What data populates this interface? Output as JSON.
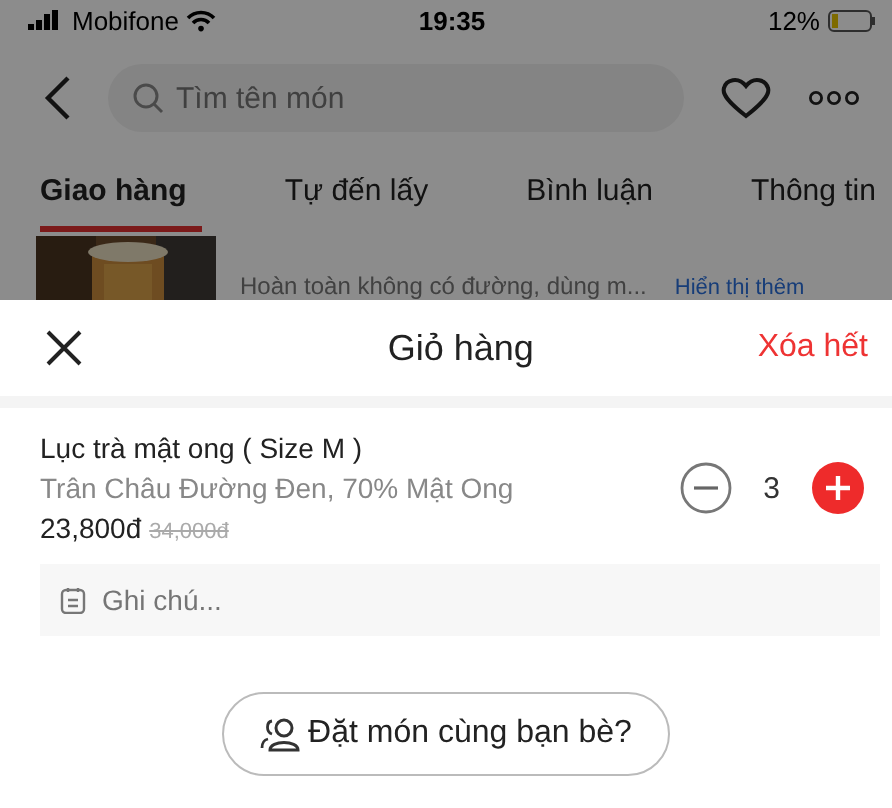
{
  "status_bar": {
    "carrier": "Mobifone",
    "time": "19:35",
    "battery": "12%"
  },
  "nav": {
    "search": {
      "placeholder": "Tìm tên món"
    }
  },
  "tabs": [
    {
      "label": "Giao hàng",
      "selected": true
    },
    {
      "label": "Tự đến lấy",
      "selected": false
    },
    {
      "label": "Bình luận",
      "selected": false
    },
    {
      "label": "Thông tin",
      "selected": false
    }
  ],
  "menu_item": {
    "kind": "picture",
    "description": "Hoàn toàn không có đường, dùng m...",
    "more_link": "Hiển thị thêm"
  },
  "cart": {
    "title": "Giỏ hàng",
    "clear_all": "Xóa hết",
    "items": [
      {
        "name": "Lục trà mật ong ( Size M )",
        "options": "Trân Châu Đường Đen, 70% Mật Ong",
        "price": "23,800đ",
        "old_price": "34,000đ",
        "quantity": "3"
      }
    ],
    "note": {
      "placeholder": "Ghi chú..."
    },
    "group_order_button": "Đặt món cùng bạn bè?"
  }
}
